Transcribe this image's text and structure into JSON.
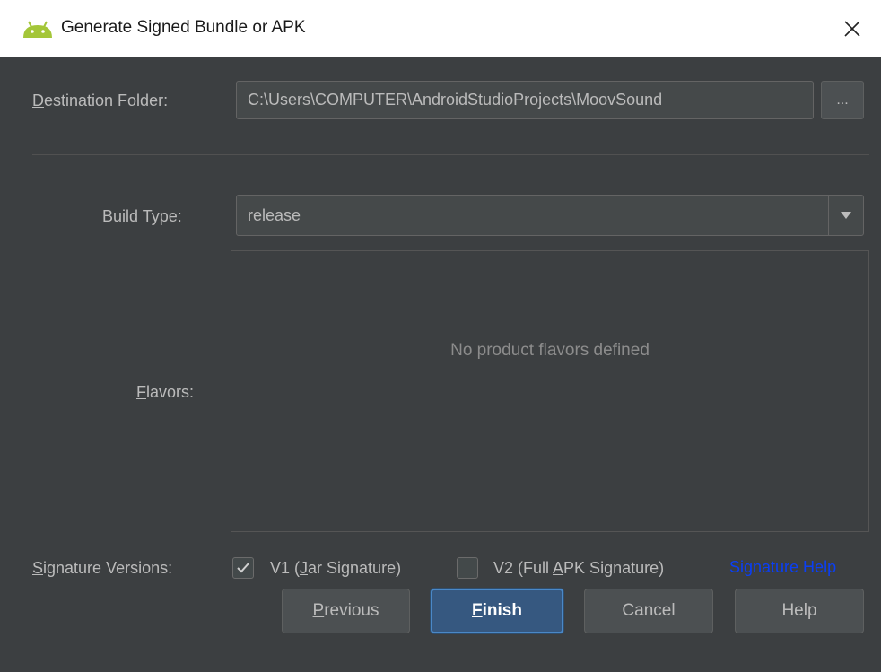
{
  "window": {
    "title": "Generate Signed Bundle or APK",
    "icon": "android-icon",
    "close_icon": "close-icon"
  },
  "destination": {
    "label_mnemonic": "D",
    "label_rest": "estination Folder:",
    "value": "C:\\Users\\COMPUTER\\AndroidStudioProjects\\MoovSound",
    "browse_label": "..."
  },
  "build_type": {
    "label_mnemonic": "B",
    "label_rest": "uild Type:",
    "value": "release"
  },
  "flavors": {
    "label_mnemonic": "F",
    "label_rest": "lavors:",
    "empty_text": "No product flavors defined"
  },
  "signature": {
    "label_mnemonic": "S",
    "label_rest": "ignature Versions:",
    "v1": {
      "pre": "V1 (",
      "mnemonic": "J",
      "post": "ar Signature)",
      "checked": true
    },
    "v2": {
      "pre": "V2 (Full ",
      "mnemonic": "A",
      "post": "PK Signature)",
      "checked": false
    },
    "help_link": "Signature Help"
  },
  "buttons": {
    "previous": {
      "mnemonic": "P",
      "rest": "revious"
    },
    "finish": {
      "mnemonic": "F",
      "rest": "inish"
    },
    "cancel": "Cancel",
    "help": "Help"
  },
  "colors": {
    "background": "#3c3f41",
    "field": "#45494a",
    "default_button": "#365880",
    "link": "#0a3ff5"
  }
}
